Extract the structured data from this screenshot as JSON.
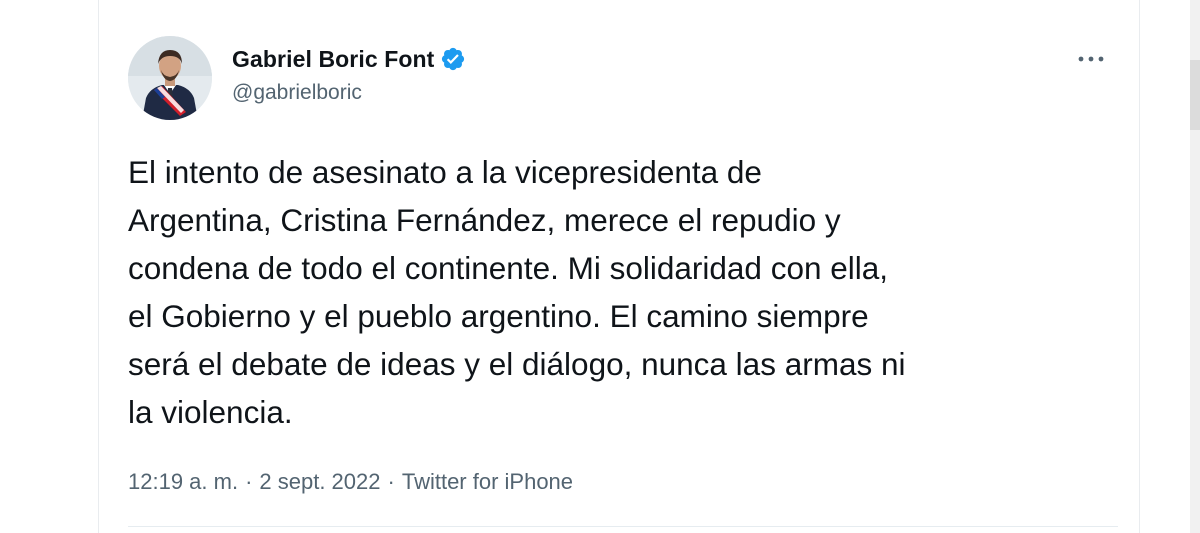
{
  "tweet": {
    "author": {
      "display_name": "Gabriel Boric Font",
      "handle": "@gabrielboric",
      "verified": true,
      "verified_icon": "verified-badge-icon",
      "verified_color": "#1d9bf0",
      "avatar_icon": "profile-photo"
    },
    "more_icon": "more-options-icon",
    "text": "El intento de asesinato a la vicepresidenta de\nArgentina, Cristina Fernández, merece el repudio y\ncondena de todo el continente. Mi solidaridad con ella,\nel Gobierno y el pueblo argentino. El camino siempre\nserá el debate de ideas y el diálogo, nunca las armas ni\nla violencia.",
    "time": "12:19 a. m.",
    "separator": "·",
    "date": "2 sept. 2022",
    "source": "Twitter for iPhone"
  },
  "colors": {
    "text_primary": "#0f1419",
    "text_secondary": "#536471",
    "accent": "#1d9bf0",
    "border": "#e9ecef"
  }
}
